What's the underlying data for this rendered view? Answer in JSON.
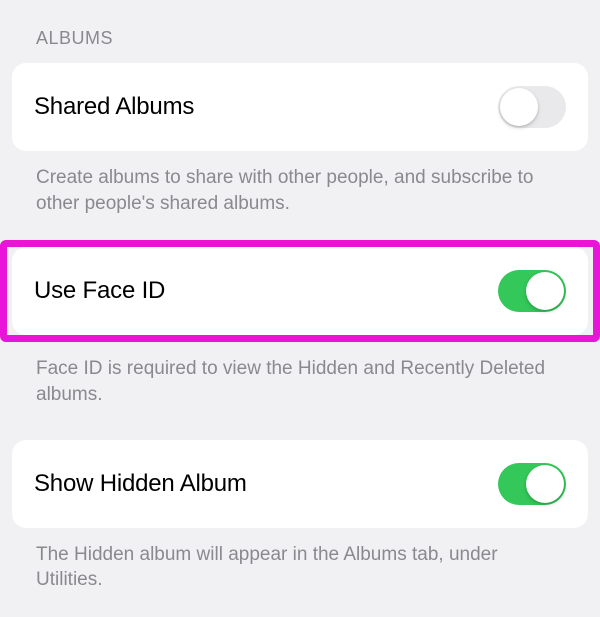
{
  "section": {
    "header": "ALBUMS"
  },
  "settings": {
    "sharedAlbums": {
      "label": "Shared Albums",
      "description": "Create albums to share with other people, and subscribe to other people's shared albums.",
      "enabled": false
    },
    "useFaceId": {
      "label": "Use Face ID",
      "description": "Face ID is required to view the Hidden and Recently Deleted albums.",
      "enabled": true
    },
    "showHiddenAlbum": {
      "label": "Show Hidden Album",
      "description": "The Hidden album will appear in the Albums tab, under Utilities.",
      "enabled": true
    }
  },
  "colors": {
    "highlight": "#e815d9",
    "toggleOn": "#34c759",
    "toggleOff": "#e9e9eb"
  }
}
